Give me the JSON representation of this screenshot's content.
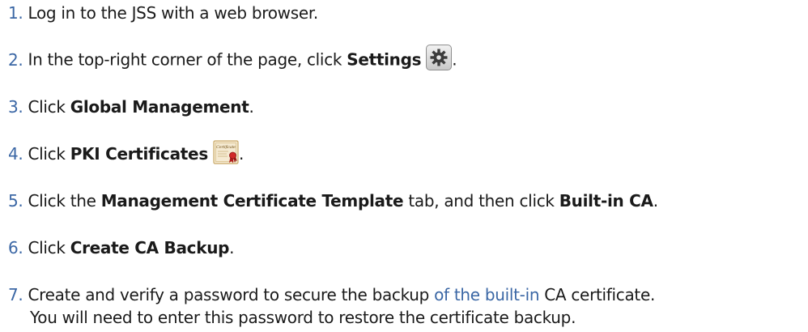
{
  "steps": [
    {
      "number": "1.",
      "before": "Log in to the JSS with a web browser."
    },
    {
      "number": "2.",
      "before": "In the top-right corner of the page, click ",
      "bold": "Settings",
      "icon": "gear-icon",
      "after": "."
    },
    {
      "number": "3.",
      "before": "Click ",
      "bold": "Global Management",
      "after": "."
    },
    {
      "number": "4.",
      "before": "Click ",
      "bold": "PKI Certificates",
      "icon": "certificate-icon",
      "after": ".",
      "icon_label": "Certificate"
    },
    {
      "number": "5.",
      "before": "Click the ",
      "bold": "Management Certificate Template",
      "middle": " tab, and then click ",
      "bold2": "Built-in CA",
      "after": "."
    },
    {
      "number": "6.",
      "before": "Click ",
      "bold": "Create CA Backup",
      "after": "."
    },
    {
      "number": "7.",
      "before": "Create and verify a password to secure the backup ",
      "link": "of the built-in",
      "after": " CA certificate.",
      "line2": "You will need to enter this password to restore the certificate backup."
    }
  ],
  "colors": {
    "number": "#3b67a5",
    "link": "#3b67a5",
    "text": "#1a1a1a"
  }
}
